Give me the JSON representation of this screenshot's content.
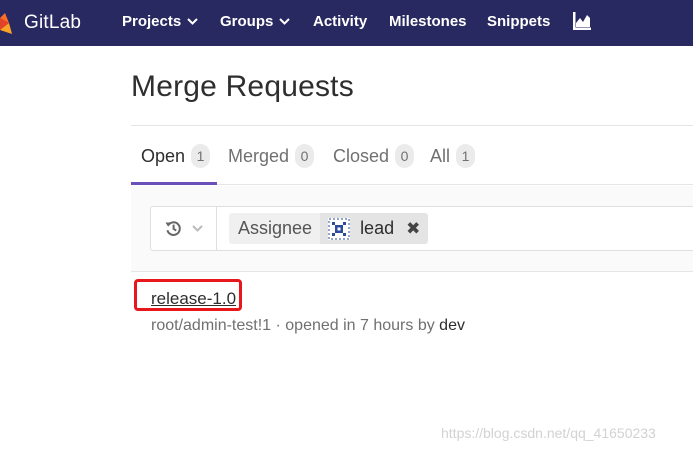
{
  "navbar": {
    "brand": "GitLab",
    "items": [
      {
        "label": "Projects",
        "dropdown": true
      },
      {
        "label": "Groups",
        "dropdown": true
      },
      {
        "label": "Activity"
      },
      {
        "label": "Milestones"
      },
      {
        "label": "Snippets"
      }
    ],
    "chart_icon": "chart-icon",
    "background": "#292961"
  },
  "page": {
    "title": "Merge Requests"
  },
  "tabs": [
    {
      "label": "Open",
      "count": "1",
      "active": true
    },
    {
      "label": "Merged",
      "count": "0"
    },
    {
      "label": "Closed",
      "count": "0"
    },
    {
      "label": "All",
      "count": "1"
    }
  ],
  "filter": {
    "history_icon": "history-icon",
    "token": {
      "name": "Assignee",
      "value": "lead",
      "avatar_icon": "identicon-avatar",
      "remove_icon": "close-icon"
    }
  },
  "merge_requests": [
    {
      "title": "release-1.0",
      "reference": "root/admin-test!1",
      "opened_prefix": " · opened in 7 hours by ",
      "author": "dev"
    }
  ],
  "annotation_color": "#e8171b",
  "watermark": "https://blog.csdn.net/qq_41650233"
}
